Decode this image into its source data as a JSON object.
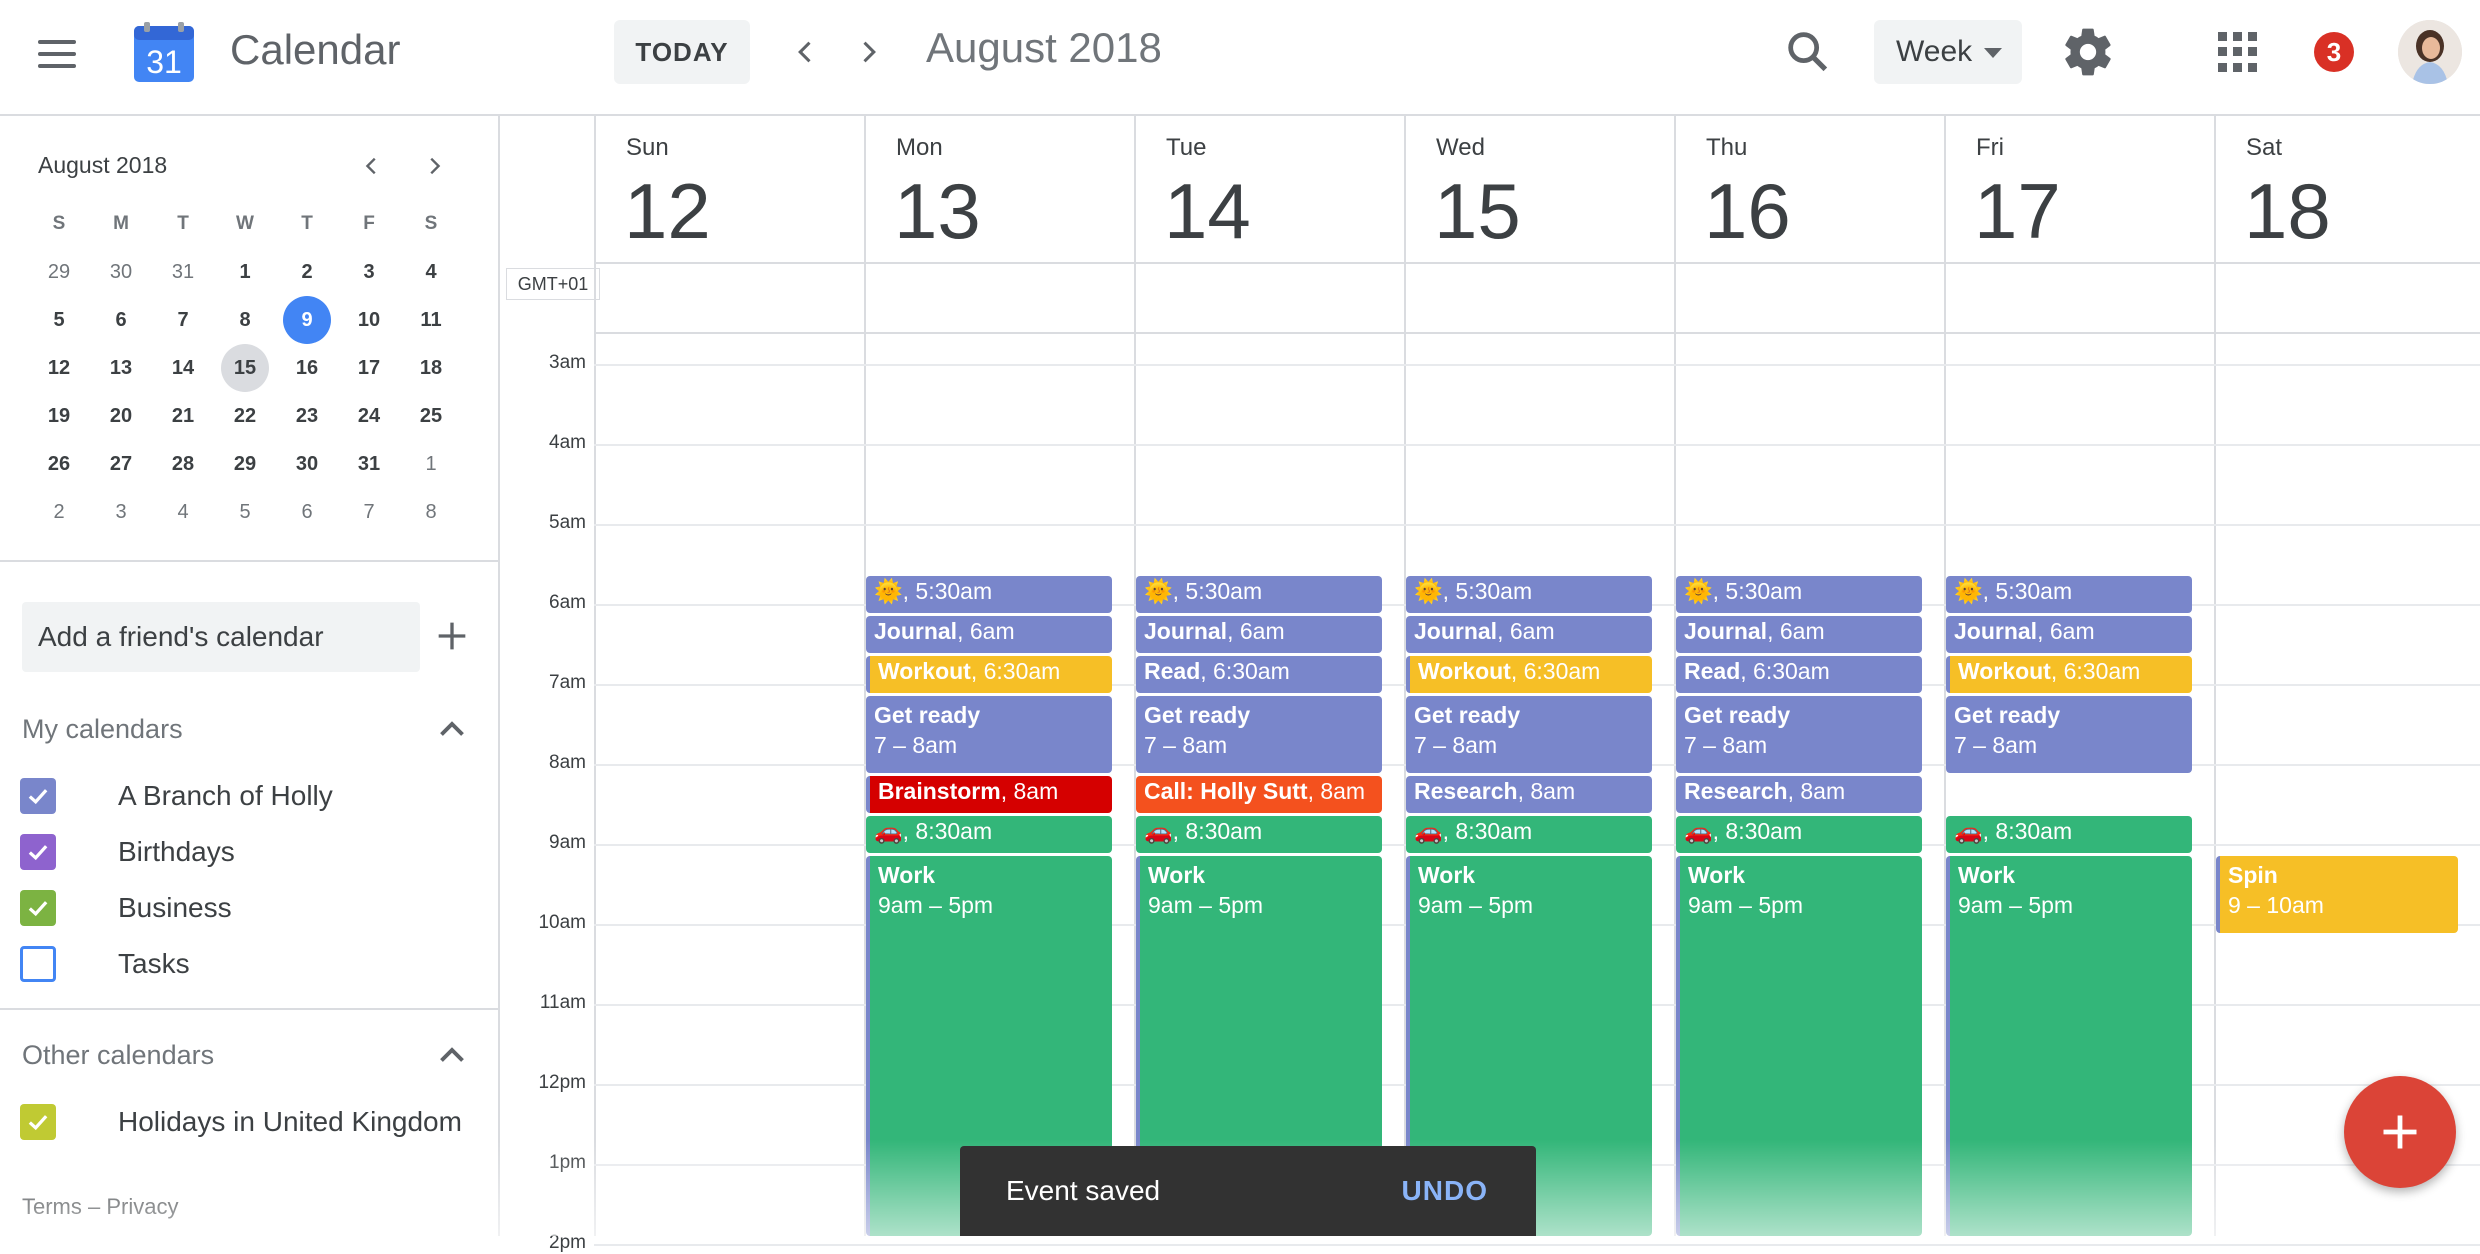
{
  "header": {
    "app_title": "Calendar",
    "logo_number": "31",
    "today_label": "TODAY",
    "month_title": "August 2018",
    "view_label": "Week",
    "notification_count": "3"
  },
  "mini_calendar": {
    "title": "August 2018",
    "weekdays": [
      "S",
      "M",
      "T",
      "W",
      "T",
      "F",
      "S"
    ],
    "weeks": [
      [
        "29",
        "30",
        "31",
        "1",
        "2",
        "3",
        "4"
      ],
      [
        "5",
        "6",
        "7",
        "8",
        "9",
        "10",
        "11"
      ],
      [
        "12",
        "13",
        "14",
        "15",
        "16",
        "17",
        "18"
      ],
      [
        "19",
        "20",
        "21",
        "22",
        "23",
        "24",
        "25"
      ],
      [
        "26",
        "27",
        "28",
        "29",
        "30",
        "31",
        "1"
      ],
      [
        "2",
        "3",
        "4",
        "5",
        "6",
        "7",
        "8"
      ]
    ],
    "today": "9",
    "selected": "15"
  },
  "sidebar": {
    "friend_placeholder": "Add a friend's calendar",
    "my_calendars_title": "My calendars",
    "my_calendars": [
      {
        "label": "A Branch of Holly",
        "color": "#7986cb",
        "checked": true
      },
      {
        "label": "Birthdays",
        "color": "#8e63ce",
        "checked": true
      },
      {
        "label": "Business",
        "color": "#7cb342",
        "checked": true
      },
      {
        "label": "Tasks",
        "color": "#4285f4",
        "checked": false
      }
    ],
    "other_calendars_title": "Other calendars",
    "other_calendars": [
      {
        "label": "Holidays in United Kingdom",
        "color": "#c0ca33",
        "checked": true
      }
    ],
    "footer": "Terms – Privacy"
  },
  "week": {
    "timezone": "GMT+01",
    "days": [
      {
        "name": "Sun",
        "num": "12"
      },
      {
        "name": "Mon",
        "num": "13"
      },
      {
        "name": "Tue",
        "num": "14"
      },
      {
        "name": "Wed",
        "num": "15"
      },
      {
        "name": "Thu",
        "num": "16"
      },
      {
        "name": "Fri",
        "num": "17"
      },
      {
        "name": "Sat",
        "num": "18"
      }
    ],
    "hours": [
      "3am",
      "4am",
      "5am",
      "6am",
      "7am",
      "8am",
      "9am",
      "10am",
      "11am",
      "12pm",
      "1pm",
      "2pm"
    ]
  },
  "events": [
    {
      "day": 1,
      "title": "🌞",
      "time": "5:30am",
      "start": 5.5,
      "end": 6.0,
      "style": "purple",
      "inline": true
    },
    {
      "day": 1,
      "title": "Journal",
      "time": "6am",
      "start": 6.0,
      "end": 6.5,
      "style": "purple",
      "inline": true
    },
    {
      "day": 1,
      "title": "Workout",
      "time": "6:30am",
      "start": 6.5,
      "end": 7.0,
      "style": "yellow",
      "inline": true
    },
    {
      "day": 1,
      "title": "Get ready",
      "time": "7 – 8am",
      "start": 7.0,
      "end": 8.0,
      "style": "purple",
      "inline": false
    },
    {
      "day": 1,
      "title": "Brainstorm",
      "time": "8am",
      "start": 8.0,
      "end": 8.5,
      "style": "red",
      "inline": true
    },
    {
      "day": 1,
      "title": "🚗",
      "time": "8:30am",
      "start": 8.5,
      "end": 9.0,
      "style": "green",
      "inline": true
    },
    {
      "day": 1,
      "title": "Work",
      "time": "9am – 5pm",
      "start": 9.0,
      "end": 17.0,
      "style": "work",
      "inline": false
    },
    {
      "day": 2,
      "title": "🌞",
      "time": "5:30am",
      "start": 5.5,
      "end": 6.0,
      "style": "purple",
      "inline": true
    },
    {
      "day": 2,
      "title": "Journal",
      "time": "6am",
      "start": 6.0,
      "end": 6.5,
      "style": "purple",
      "inline": true
    },
    {
      "day": 2,
      "title": "Read",
      "time": "6:30am",
      "start": 6.5,
      "end": 7.0,
      "style": "purple",
      "inline": true
    },
    {
      "day": 2,
      "title": "Get ready",
      "time": "7 – 8am",
      "start": 7.0,
      "end": 8.0,
      "style": "purple",
      "inline": false
    },
    {
      "day": 2,
      "title": "Call: Holly Sutt",
      "time": "8am",
      "start": 8.0,
      "end": 8.5,
      "style": "orange",
      "inline": true
    },
    {
      "day": 2,
      "title": "🚗",
      "time": "8:30am",
      "start": 8.5,
      "end": 9.0,
      "style": "green",
      "inline": true
    },
    {
      "day": 2,
      "title": "Work",
      "time": "9am – 5pm",
      "start": 9.0,
      "end": 17.0,
      "style": "work",
      "inline": false
    },
    {
      "day": 3,
      "title": "🌞",
      "time": "5:30am",
      "start": 5.5,
      "end": 6.0,
      "style": "purple",
      "inline": true
    },
    {
      "day": 3,
      "title": "Journal",
      "time": "6am",
      "start": 6.0,
      "end": 6.5,
      "style": "purple",
      "inline": true
    },
    {
      "day": 3,
      "title": "Workout",
      "time": "6:30am",
      "start": 6.5,
      "end": 7.0,
      "style": "yellow",
      "inline": true
    },
    {
      "day": 3,
      "title": "Get ready",
      "time": "7 – 8am",
      "start": 7.0,
      "end": 8.0,
      "style": "purple",
      "inline": false
    },
    {
      "day": 3,
      "title": "Research",
      "time": "8am",
      "start": 8.0,
      "end": 8.5,
      "style": "purple",
      "inline": true
    },
    {
      "day": 3,
      "title": "🚗",
      "time": "8:30am",
      "start": 8.5,
      "end": 9.0,
      "style": "green",
      "inline": true
    },
    {
      "day": 3,
      "title": "Work",
      "time": "9am – 5pm",
      "start": 9.0,
      "end": 17.0,
      "style": "work",
      "inline": false
    },
    {
      "day": 4,
      "title": "🌞",
      "time": "5:30am",
      "start": 5.5,
      "end": 6.0,
      "style": "purple",
      "inline": true
    },
    {
      "day": 4,
      "title": "Journal",
      "time": "6am",
      "start": 6.0,
      "end": 6.5,
      "style": "purple",
      "inline": true
    },
    {
      "day": 4,
      "title": "Read",
      "time": "6:30am",
      "start": 6.5,
      "end": 7.0,
      "style": "purple",
      "inline": true
    },
    {
      "day": 4,
      "title": "Get ready",
      "time": "7 – 8am",
      "start": 7.0,
      "end": 8.0,
      "style": "purple",
      "inline": false
    },
    {
      "day": 4,
      "title": "Research",
      "time": "8am",
      "start": 8.0,
      "end": 8.5,
      "style": "purple",
      "inline": true
    },
    {
      "day": 4,
      "title": "🚗",
      "time": "8:30am",
      "start": 8.5,
      "end": 9.0,
      "style": "green",
      "inline": true
    },
    {
      "day": 4,
      "title": "Work",
      "time": "9am – 5pm",
      "start": 9.0,
      "end": 17.0,
      "style": "work",
      "inline": false
    },
    {
      "day": 5,
      "title": "🌞",
      "time": "5:30am",
      "start": 5.5,
      "end": 6.0,
      "style": "purple",
      "inline": true
    },
    {
      "day": 5,
      "title": "Journal",
      "time": "6am",
      "start": 6.0,
      "end": 6.5,
      "style": "purple",
      "inline": true
    },
    {
      "day": 5,
      "title": "Workout",
      "time": "6:30am",
      "start": 6.5,
      "end": 7.0,
      "style": "yellow",
      "inline": true
    },
    {
      "day": 5,
      "title": "Get ready",
      "time": "7 – 8am",
      "start": 7.0,
      "end": 8.0,
      "style": "purple",
      "inline": false
    },
    {
      "day": 5,
      "title": "🚗",
      "time": "8:30am",
      "start": 8.5,
      "end": 9.0,
      "style": "green",
      "inline": true
    },
    {
      "day": 5,
      "title": "Work",
      "time": "9am – 5pm",
      "start": 9.0,
      "end": 17.0,
      "style": "work",
      "inline": false
    },
    {
      "day": 6,
      "title": "Spin",
      "time": "9 – 10am",
      "start": 9.0,
      "end": 10.0,
      "style": "spin",
      "inline": false
    }
  ],
  "snackbar": {
    "message": "Event saved",
    "action": "UNDO"
  },
  "icons": {
    "menu": "hamburger-icon",
    "search": "search-icon",
    "settings": "gear-icon",
    "apps": "apps-grid-icon",
    "create": "plus-icon"
  },
  "colors": {
    "accent_blue": "#4285f4",
    "event_purple": "#7986cb",
    "event_green": "#33b679",
    "event_yellow": "#f6bf26",
    "event_red": "#d50000",
    "event_orange": "#f4511e",
    "fab_red": "#db4437"
  }
}
